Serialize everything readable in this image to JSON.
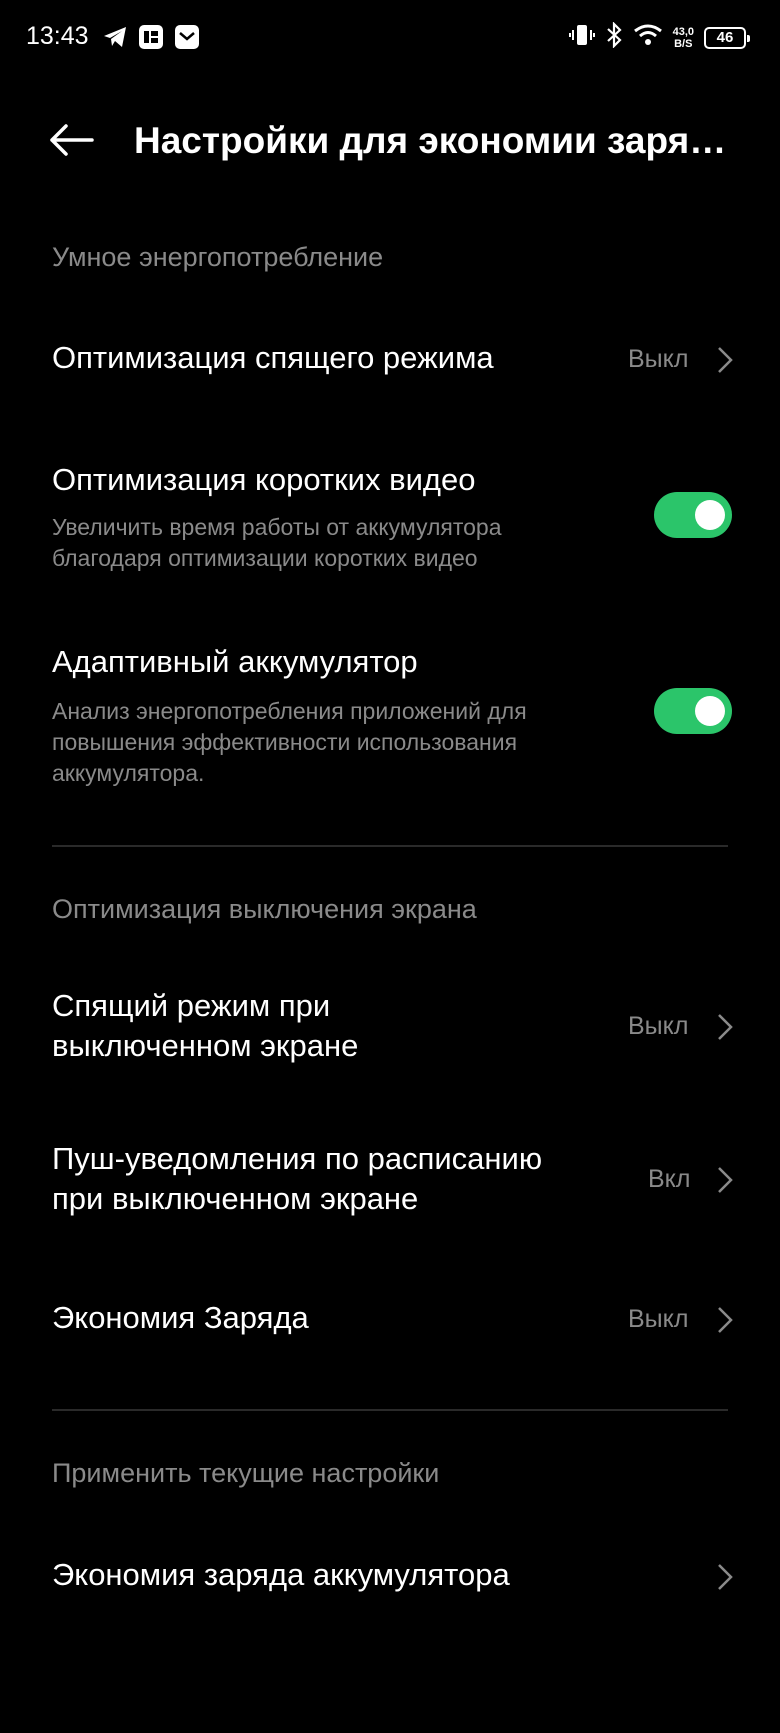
{
  "status_bar": {
    "time": "13:43",
    "net_speed_value": "43,0",
    "net_speed_unit": "B/S",
    "battery_level": "46",
    "icons_left": [
      "telegram-icon",
      "app-icon",
      "mail-icon"
    ],
    "icons_right": [
      "vibrate-icon",
      "bluetooth-icon",
      "wifi-icon",
      "battery-icon"
    ]
  },
  "header": {
    "title": "Настройки для экономии заря…"
  },
  "sections": [
    {
      "title": "Умное энергопотребление",
      "items": [
        {
          "title": "Оптимизация спящего режима",
          "value": "Выкл"
        },
        {
          "title": "Оптимизация коротких видео",
          "description_line1": "Увеличить время работы от аккумулятора",
          "description_line2": "благодаря оптимизации коротких видео",
          "toggle_on": true
        },
        {
          "title": "Адаптивный аккумулятор",
          "description_line1": "Анализ энергопотребления приложений для",
          "description_line2": "повышения эффективности использования",
          "description_line3": "аккумулятора.",
          "toggle_on": true
        }
      ]
    },
    {
      "title": "Оптимизация выключения экрана",
      "items": [
        {
          "title_line1": "Спящий режим при",
          "title_line2": "выключенном экране",
          "value": "Выкл"
        },
        {
          "title_line1": "Пуш-уведомления по расписанию",
          "title_line2": "при выключенном экране",
          "value": "Вкл"
        },
        {
          "title": "Экономия Заряда",
          "value": "Выкл"
        }
      ]
    },
    {
      "title": "Применить текущие настройки",
      "items": [
        {
          "title": "Экономия заряда аккумулятора"
        }
      ]
    }
  ],
  "colors": {
    "background": "#000000",
    "toggle_on": "#2bc56a",
    "secondary_text": "#8a8a8a"
  }
}
